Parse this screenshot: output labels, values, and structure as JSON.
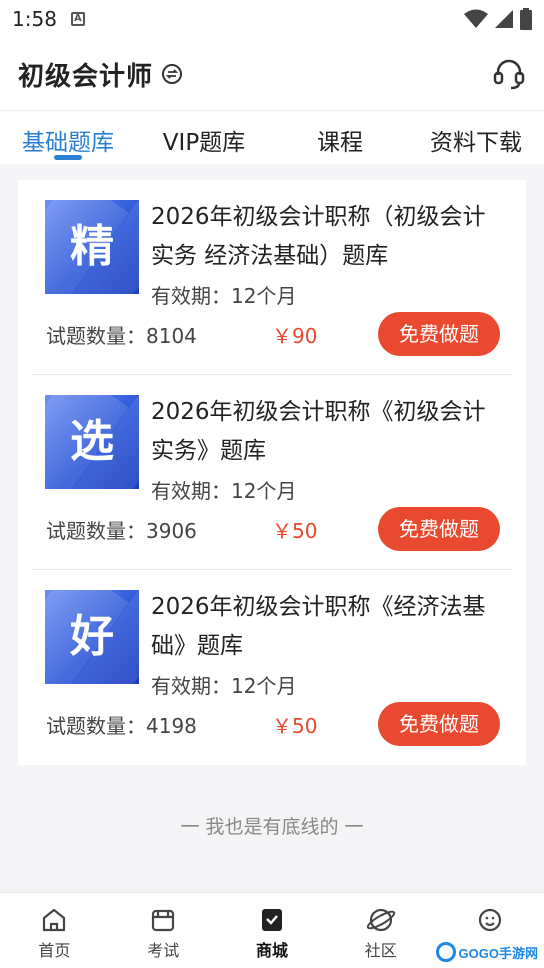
{
  "status_bar": {
    "time": "1:58",
    "notif_glyph": "A"
  },
  "app_bar": {
    "title": "初级会计师"
  },
  "tabs": [
    {
      "label": "基础题库",
      "active": true
    },
    {
      "label": "VIP题库",
      "active": false
    },
    {
      "label": "课程",
      "active": false
    },
    {
      "label": "资料下载",
      "active": false
    }
  ],
  "items": [
    {
      "thumb_char": "精",
      "title": "2026年初级会计职称（初级会计实务 经济法基础）题库",
      "validity": "有效期：12个月",
      "count": "试题数量：8104",
      "price": "￥90",
      "button": "免费做题"
    },
    {
      "thumb_char": "选",
      "title": "2026年初级会计职称《初级会计实务》题库",
      "validity": "有效期：12个月",
      "count": "试题数量：3906",
      "price": "￥50",
      "button": "免费做题"
    },
    {
      "thumb_char": "好",
      "title": "2026年初级会计职称《经济法基础》题库",
      "validity": "有效期：12个月",
      "count": "试题数量：4198",
      "price": "￥50",
      "button": "免费做题"
    }
  ],
  "footer_text": "一  我也是有底线的  一",
  "bottom_nav": [
    {
      "label": "首页",
      "icon": "home-icon",
      "active": false
    },
    {
      "label": "考试",
      "icon": "exam-icon",
      "active": false
    },
    {
      "label": "商城",
      "icon": "store-icon",
      "active": true
    },
    {
      "label": "社区",
      "icon": "community-icon",
      "active": false
    },
    {
      "label": "",
      "icon": "profile-icon",
      "active": false
    }
  ],
  "watermark": "GOGO手游网",
  "colors": {
    "accent": "#2a7fd4",
    "price": "#e8492f",
    "button": "#e8492f"
  }
}
